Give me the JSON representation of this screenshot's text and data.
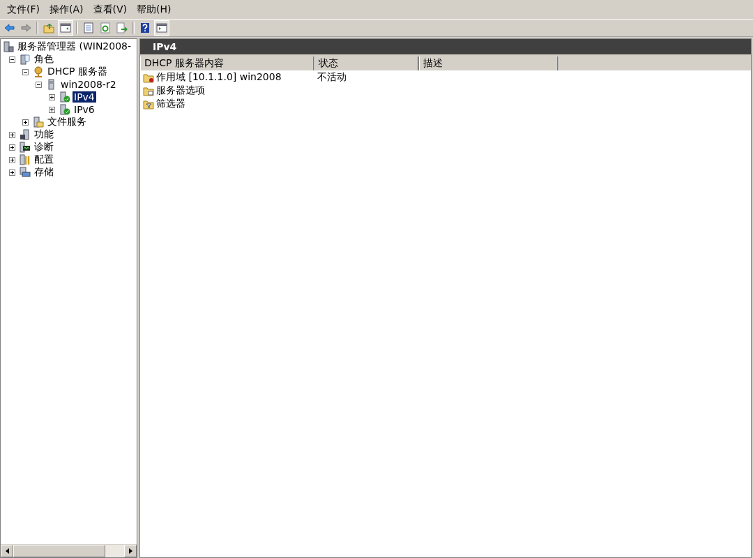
{
  "menu": [
    "文件(F)",
    "操作(A)",
    "查看(V)",
    "帮助(H)"
  ],
  "toolbar": [
    {
      "kind": "back",
      "disabled": false
    },
    {
      "kind": "forward",
      "disabled": true
    },
    {
      "kind": "sep"
    },
    {
      "kind": "up-folder",
      "disabled": false
    },
    {
      "kind": "tree-toggle",
      "disabled": false,
      "on": true
    },
    {
      "kind": "sep"
    },
    {
      "kind": "properties",
      "disabled": false
    },
    {
      "kind": "refresh",
      "disabled": false
    },
    {
      "kind": "export",
      "disabled": false
    },
    {
      "kind": "sep"
    },
    {
      "kind": "help",
      "disabled": false
    },
    {
      "kind": "action-pane",
      "disabled": false,
      "on": true
    }
  ],
  "tree": [
    {
      "label": "服务器管理器 (WIN2008-",
      "kind": "manager",
      "selected": false,
      "children": [
        {
          "label": "角色",
          "kind": "roles",
          "expanded": true,
          "selected": false,
          "children": [
            {
              "label": "DHCP 服务器",
              "kind": "dhcp",
              "expanded": true,
              "selected": false,
              "children": [
                {
                  "label": "win2008-r2",
                  "kind": "server",
                  "expanded": true,
                  "selected": false,
                  "children": [
                    {
                      "label": "IPv4",
                      "kind": "network",
                      "expanded": false,
                      "selected": true
                    },
                    {
                      "label": "IPv6",
                      "kind": "network",
                      "expanded": false,
                      "selected": false
                    }
                  ]
                }
              ]
            },
            {
              "label": "文件服务",
              "kind": "files",
              "expanded": false,
              "selected": false
            }
          ]
        },
        {
          "label": "功能",
          "kind": "features",
          "expanded": false,
          "selected": false
        },
        {
          "label": "诊断",
          "kind": "diagnostics",
          "expanded": false,
          "selected": false
        },
        {
          "label": "配置",
          "kind": "config",
          "expanded": false,
          "selected": false
        },
        {
          "label": "存储",
          "kind": "storage",
          "expanded": false,
          "selected": false
        }
      ]
    }
  ],
  "pane": {
    "title": "IPv4",
    "columns": [
      "DHCP 服务器内容",
      "状态",
      "描述"
    ],
    "rows": [
      {
        "kind": "scope",
        "name": "作用域 [10.1.1.0] win2008",
        "status": "不活动"
      },
      {
        "kind": "options",
        "name": "服务器选项"
      },
      {
        "kind": "filter",
        "name": "筛选器"
      }
    ]
  }
}
